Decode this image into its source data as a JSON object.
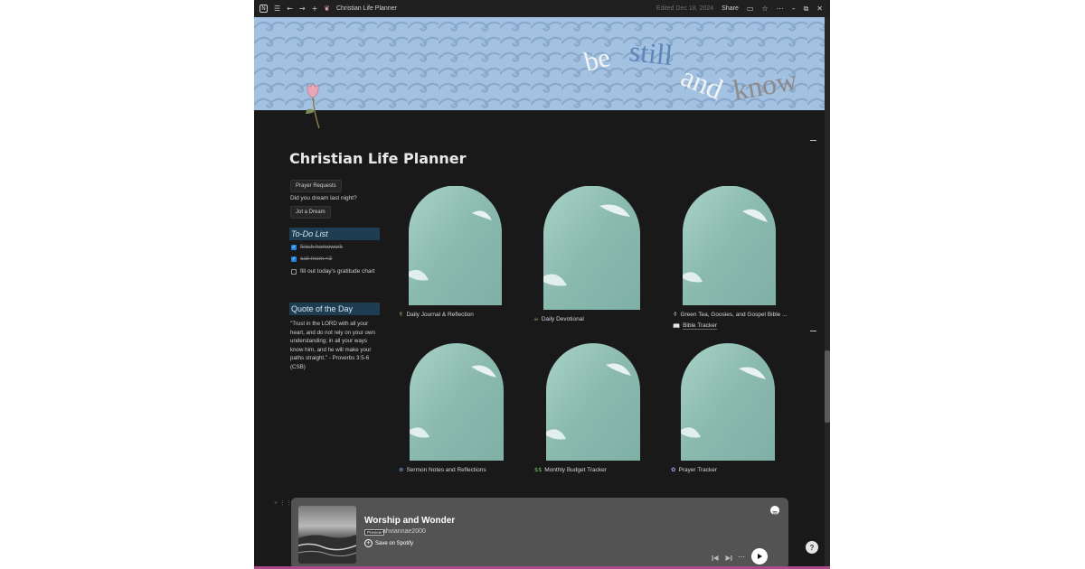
{
  "titlebar": {
    "title": "Christian Life Planner",
    "edited": "Edited Dec 18, 2024",
    "share": "Share",
    "icons": [
      "notion-logo-icon",
      "menu-icon",
      "back-arrow-icon",
      "forward-arrow-icon",
      "plus-icon",
      "tulip-small-icon",
      "comment-icon",
      "star-icon",
      "more-icon",
      "minimize-icon",
      "restore-icon",
      "close-icon"
    ]
  },
  "banner": {
    "text": [
      "be",
      "still",
      "and",
      "know"
    ]
  },
  "page": {
    "title": "Christian Life Planner"
  },
  "sidebar": {
    "prayer_button": "Prayer Requests",
    "dream_question": "Did you dream last night?",
    "dream_button": "Jot a Dream",
    "todo_header": "To-Do List",
    "todos": [
      {
        "text": "finish homework",
        "done": true
      },
      {
        "text": "call mom <3",
        "done": true
      },
      {
        "text": "fill out today's gratitude chart",
        "done": false
      }
    ],
    "quote_header": "Quote of the Day",
    "quote": "\"Trust in the LORD with all your heart, and do not rely on your own understanding; in all your ways know him, and he will make your paths straight.\" - Proverbs 3:5-6 (CSB)"
  },
  "cards": [
    {
      "emoji": "✌",
      "label": "Daily Journal & Reflection"
    },
    {
      "emoji": "☕",
      "label": "Daily Devotional"
    },
    {
      "emoji": "⚱",
      "label": "Green Tea, Goosies, and Gospel Bible ...",
      "sub_emoji": "📖",
      "sub_label": "Bible Tracker"
    },
    {
      "emoji": "⊕",
      "label": "Sermon Notes and Reflections"
    },
    {
      "emoji": "$$",
      "label": "Monthly Budget Tracker"
    },
    {
      "emoji": "✿",
      "label": "Prayer Tracker"
    }
  ],
  "player": {
    "title": "Worship and Wonder",
    "preview": "Preview",
    "user": "ahviannae2000",
    "save": "Save on Spotify"
  },
  "help": "?",
  "colors": {
    "banner": "#a3c2e2",
    "header_bg": "#1e3c52",
    "page_bg": "#191919",
    "arch": "#8fbdb3"
  }
}
